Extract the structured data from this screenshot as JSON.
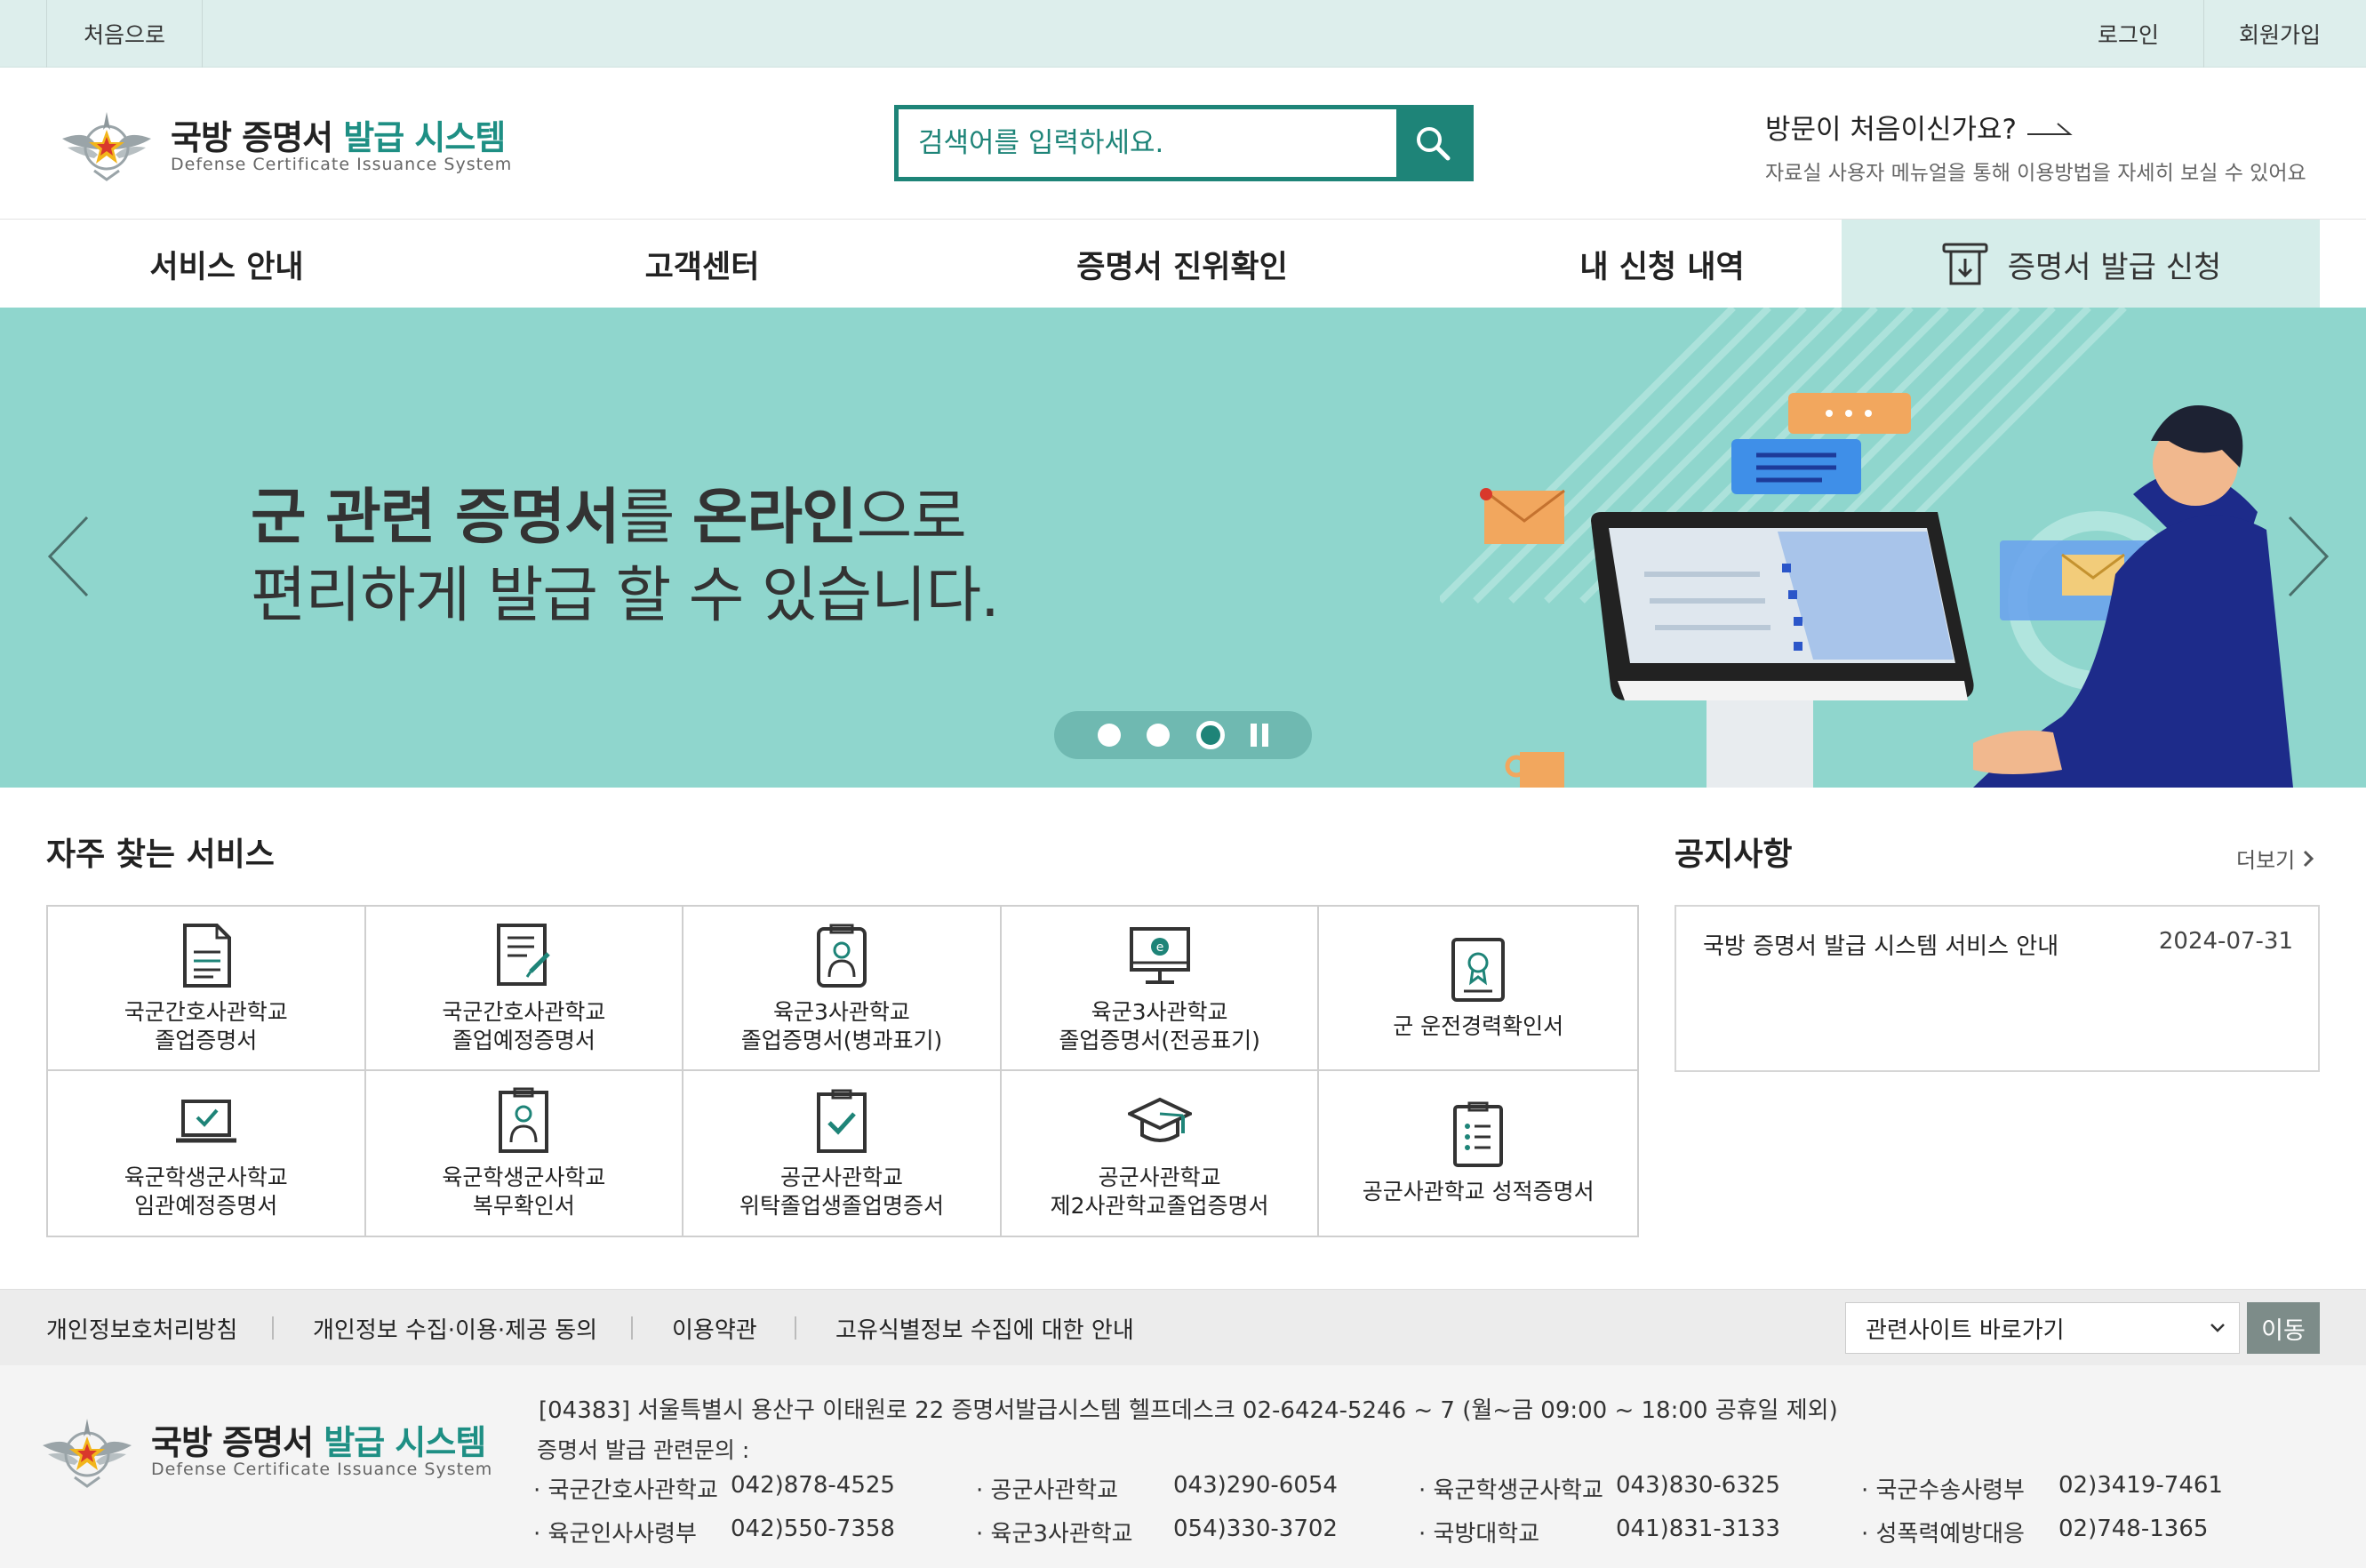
{
  "topbar": {
    "home": "처음으로",
    "login": "로그인",
    "join": "회원가입"
  },
  "header": {
    "logo_title_main": "국방 증명서 ",
    "logo_title_accent": "발급 시스템",
    "logo_subtitle": "Defense Certificate Issuance System",
    "search_placeholder": "검색어를 입력하세요.",
    "visit_question": "방문이 처음이신가요?",
    "visit_desc": "자료실 사용자 메뉴얼을 통해 이용방법을 자세히 보실 수 있어요"
  },
  "nav": {
    "items": [
      "서비스 안내",
      "고객센터",
      "증명서 진위확인",
      "내 신청 내역"
    ],
    "apply": "증명서 발급 신청"
  },
  "banner": {
    "line1_bold1": "군 관련 증명서",
    "line1_mid": "를 ",
    "line1_bold2": "온라인",
    "line1_end": "으로",
    "line2": "편리하게 발급 할 수 있습니다."
  },
  "services": {
    "title": "자주 찾는 서비스",
    "items": [
      {
        "label": "국군간호사관학교\n졸업증명서",
        "icon": "document-icon"
      },
      {
        "label": "국군간호사관학교\n졸업예정증명서",
        "icon": "document-pen-icon"
      },
      {
        "label": "육군3사관학교\n졸업증명서(병과표기)",
        "icon": "badge-icon"
      },
      {
        "label": "육군3사관학교\n졸업증명서(전공표기)",
        "icon": "monitor-icon"
      },
      {
        "label": "군 운전경력확인서",
        "icon": "certificate-icon"
      },
      {
        "label": "육군학생군사학교\n임관예정증명서",
        "icon": "laptop-check-icon"
      },
      {
        "label": "육군학생군사학교\n복무확인서",
        "icon": "person-card-icon"
      },
      {
        "label": "공군사관학교\n위탁졸업생졸업명증서",
        "icon": "clipboard-check-icon"
      },
      {
        "label": "공군사관학교\n제2사관학교졸업증명서",
        "icon": "graduation-cap-icon"
      },
      {
        "label": "공군사관학교 성적증명서",
        "icon": "list-document-icon"
      }
    ]
  },
  "notice": {
    "title": "공지사항",
    "more": "더보기",
    "items": [
      {
        "title": "국방 증명서 발급 시스템 서비스 안내",
        "date": "2024-07-31"
      }
    ]
  },
  "footer": {
    "links": [
      "개인정보호처리방침",
      "개인정보 수집·이용·제공 동의",
      "이용약관",
      "고유식별정보 수집에 대한 안내"
    ],
    "select": "관련사이트 바로가기",
    "go": "이동",
    "address": "[04383] 서울특별시 용산구 이태원로 22 증명서발급시스템 헬프데스크 02-6424-5246 ~ 7 (월~금 09:00 ~ 18:00 공휴일 제외)",
    "inquiry": "증명서 발급 관련문의 :",
    "contacts": [
      {
        "org": "· 국군간호사관학교",
        "tel": "042)878-4525"
      },
      {
        "org": "· 공군사관학교",
        "tel": "043)290-6054"
      },
      {
        "org": "· 육군학생군사학교",
        "tel": "043)830-6325"
      },
      {
        "org": "· 국군수송사령부",
        "tel": "02)3419-7461"
      },
      {
        "org": "· 육군인사사령부",
        "tel": "042)550-7358"
      },
      {
        "org": "· 육군3사관학교",
        "tel": "054)330-3702"
      },
      {
        "org": "· 국방대학교",
        "tel": "041)831-3133"
      },
      {
        "org": "· 성폭력예방대응",
        "tel": "02)748-1365"
      }
    ]
  },
  "colors": {
    "accent": "#1e8478",
    "banner_bg": "#8fd6cd",
    "topbar_bg": "#ddeeec",
    "apply_bg": "#d6edea"
  }
}
